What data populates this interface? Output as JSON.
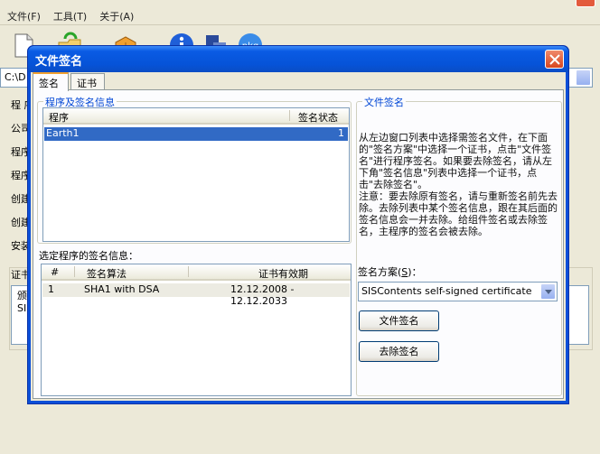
{
  "background": {
    "menu": [
      "文件(F)",
      "工具(T)",
      "关于(A)"
    ],
    "path_prefix": "C:\\D",
    "side_labels": [
      "程 序",
      "公司",
      "程序",
      "程序",
      "创建",
      "创建",
      "安装"
    ],
    "cert_section_label": "证书",
    "cert_list_col": "颁",
    "cert_list_row": "SIS"
  },
  "dialog": {
    "title": "文件签名",
    "tabs": [
      "签名",
      "证书"
    ],
    "program_group": {
      "title": "程序及签名信息",
      "columns": [
        "程序",
        "签名状态"
      ],
      "rows": [
        {
          "program": "Earth1",
          "status": "1"
        }
      ]
    },
    "selected_sig_label": "选定程序的签名信息：",
    "sig_list": {
      "columns": [
        "#",
        "签名算法",
        "证书有效期"
      ],
      "rows": [
        {
          "num": "1",
          "algorithm": "SHA1 with DSA",
          "validity": "12.12.2008 - 12.12.2033"
        }
      ]
    },
    "file_sign_group": {
      "title": "文件签名",
      "info_lines": [
        "从左边窗口列表中选择需签名文件，在下面的\"签名方案\"中选择一个证书，点击\"文件签名\"进行程序签名。如果要去除签名，请从左下角\"签名信息\"列表中选择一个证书，点击\"去除签名\"。",
        "注意：要去除原有签名，请与重新签名前先去除。去除列表中某个签名信息，跟在其后面的签名信息会一并去除。给组件签名或去除签名，主程序的签名会被去除。"
      ],
      "scheme_label": "签名方案",
      "scheme_hotkey": "S",
      "scheme_value": "SISContents self-signed certificate",
      "sign_button": "文件签名",
      "remove_button": "去除签名"
    }
  }
}
